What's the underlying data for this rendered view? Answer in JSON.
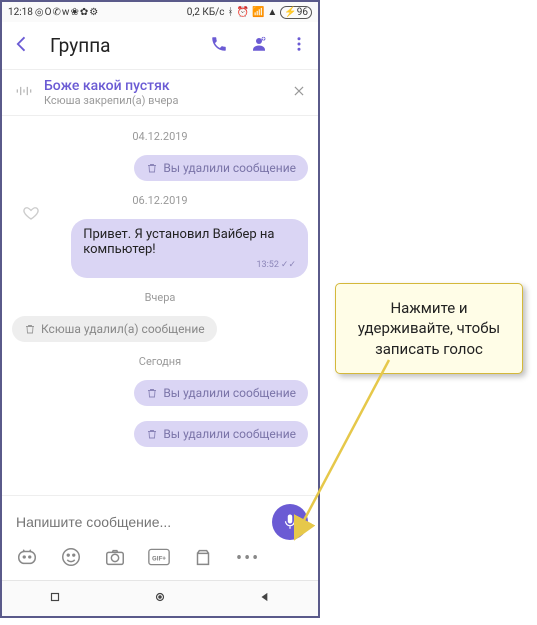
{
  "status": {
    "time": "12:18",
    "speed": "0,2 КБ/с",
    "battery": "96"
  },
  "header": {
    "title": "Группа"
  },
  "pinned": {
    "title": "Боже какой пустяк",
    "subtitle": "Ксюша закрепил(а) вчера"
  },
  "dates": {
    "d1": "04.12.2019",
    "d2": "06.12.2019",
    "d3": "Вчера",
    "d4": "Сегодня"
  },
  "msgs": {
    "deleted_you": "Вы удалили сообщение",
    "hello": "Привет. Я установил Вайбер на компьютер!",
    "hello_time": "13:52",
    "deleted_other": "Ксюша удалил(а) сообщение"
  },
  "composer": {
    "placeholder": "Напишите сообщение..."
  },
  "callout": {
    "text": "Нажмите и удерживайте, чтобы записать голос"
  }
}
